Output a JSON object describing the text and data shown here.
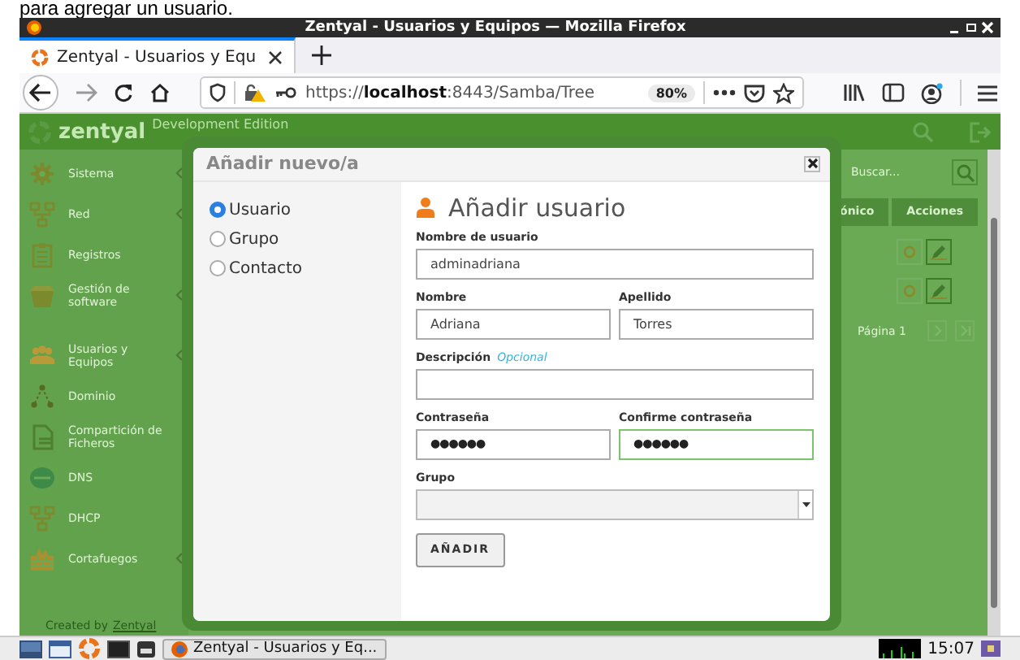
{
  "caption": "para agregar un usuario.",
  "window": {
    "title": "Zentyal - Usuarios y Equipos — Mozilla Firefox"
  },
  "tabs": [
    {
      "label": "Zentyal - Usuarios y Equ",
      "selected": true
    }
  ],
  "address_bar": {
    "url": "https://**localhost**:8443/Samba/Tree",
    "zoom": "80%"
  },
  "app": {
    "brand": "zentyal",
    "edition": "Development Edition",
    "search_placeholder": "Buscar...",
    "sidebar": [
      {
        "label": "Sistema",
        "expandable": true
      },
      {
        "label": "Red",
        "expandable": true
      },
      {
        "label": "Registros",
        "expandable": false
      },
      {
        "label": "Gestión de software",
        "expandable": true
      },
      {
        "label": "Usuarios y Equipos",
        "expandable": true
      },
      {
        "label": "Dominio",
        "expandable": false
      },
      {
        "label": "Compartición de Ficheros",
        "expandable": false
      },
      {
        "label": "DNS",
        "expandable": false
      },
      {
        "label": "DHCP",
        "expandable": false
      },
      {
        "label": "Cortafuegos",
        "expandable": true
      }
    ],
    "columns": [
      "ónico",
      "Acciones"
    ],
    "pager": "Página 1",
    "footer": {
      "text": "Created by",
      "link": "Zentyal"
    }
  },
  "dialog": {
    "title": "Añadir nuevo/a",
    "options": [
      {
        "label": "Usuario",
        "selected": true
      },
      {
        "label": "Grupo",
        "selected": false
      },
      {
        "label": "Contacto",
        "selected": false
      }
    ],
    "form_title": "Añadir usuario",
    "rows": [
      [
        {
          "kind": "text",
          "label": "Nombre de usuario",
          "value": "adminadriana",
          "focused": false
        }
      ],
      [
        {
          "kind": "text",
          "label": "Nombre",
          "value": "Adriana",
          "focused": false
        },
        {
          "kind": "text",
          "label": "Apellido",
          "value": "Torres",
          "focused": false
        }
      ],
      [
        {
          "kind": "text",
          "label": "Descripción",
          "hint": "Opcional",
          "focused": false
        }
      ],
      [
        {
          "kind": "password",
          "label": "Contraseña",
          "value": "●●●●●●",
          "focused": false
        },
        {
          "kind": "password",
          "label": "Confirme contraseña",
          "value": "●●●●●●",
          "focused": true
        }
      ],
      [
        {
          "kind": "select",
          "label": "Grupo",
          "focused": false
        }
      ]
    ],
    "submit": "AÑADIR"
  },
  "taskbar": {
    "task": "Zentyal - Usuarios y Eq...",
    "clock": "15:07"
  }
}
